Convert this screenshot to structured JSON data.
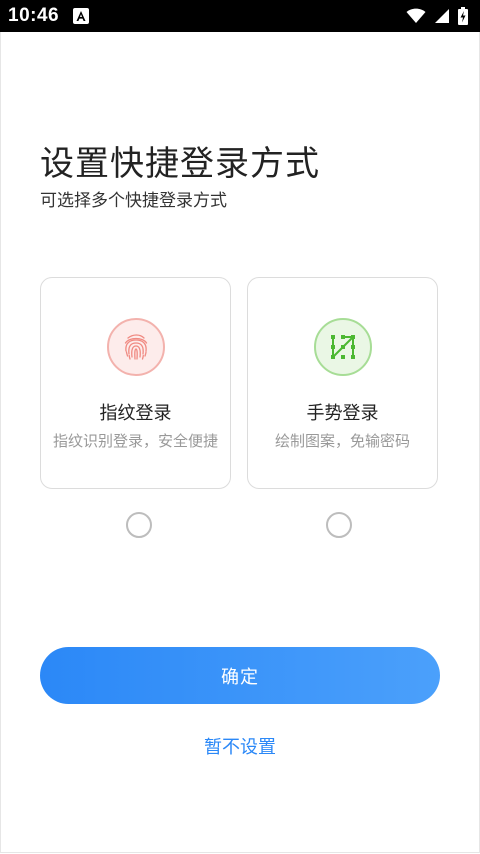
{
  "status_bar": {
    "time": "10:46",
    "icons": [
      "a-icon",
      "wifi-icon",
      "signal-icon",
      "battery-charging-icon"
    ]
  },
  "page": {
    "title": "设置快捷登录方式",
    "subtitle": "可选择多个快捷登录方式"
  },
  "options": [
    {
      "icon": "fingerprint-icon",
      "title": "指纹登录",
      "desc": "指纹识别登录，安全便捷",
      "selected": false,
      "accent": "#f08a82"
    },
    {
      "icon": "gesture-pattern-icon",
      "title": "手势登录",
      "desc": "绘制图案，免输密码",
      "selected": false,
      "accent": "#4cb832"
    }
  ],
  "actions": {
    "confirm_label": "确定",
    "skip_label": "暂不设置"
  },
  "colors": {
    "primary": "#2b88f7",
    "primary_end": "#4ba0fb"
  }
}
